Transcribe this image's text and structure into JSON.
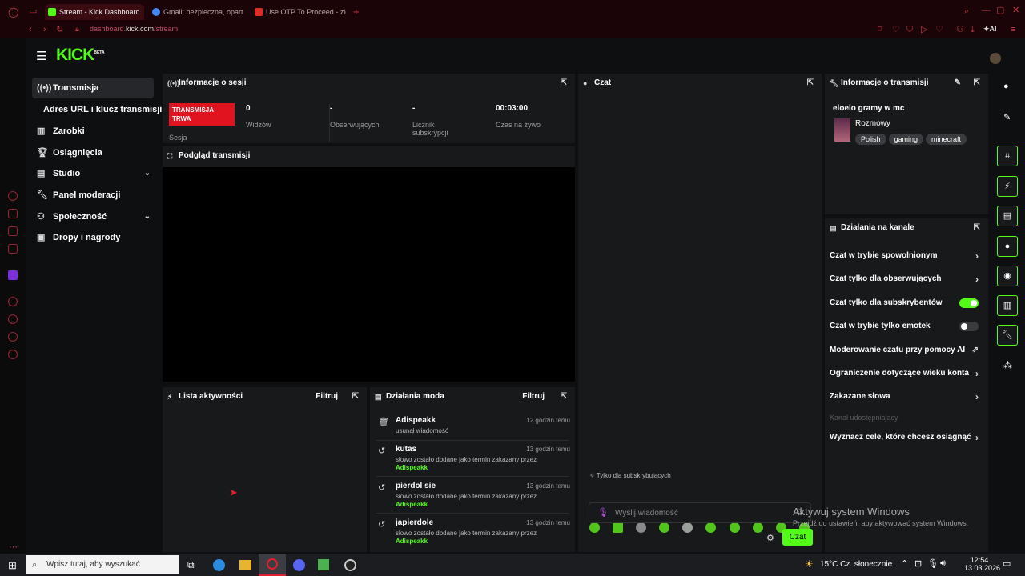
{
  "browser": {
    "tabs": [
      {
        "title": "Stream - Kick Dashboard",
        "active": true
      },
      {
        "title": "Gmail: bezpieczna, opart",
        "active": false
      },
      {
        "title": "Use OTP To Proceed - zie",
        "active": false
      }
    ],
    "url_prefix": "dashboard.",
    "url_domain": "kick.com",
    "url_path": "/stream",
    "ai_label": "AI"
  },
  "logo": "KICK",
  "logo_badge": "BETA",
  "sidebar": {
    "items": [
      {
        "label": "Transmisja",
        "icon": "broadcast-icon"
      },
      {
        "label": "Adres URL i klucz transmisji"
      },
      {
        "label": "Zarobki",
        "icon": "chart-icon"
      },
      {
        "label": "Osiągnięcia",
        "icon": "trophy-icon"
      },
      {
        "label": "Studio",
        "icon": "studio-icon"
      },
      {
        "label": "Panel moderacji",
        "icon": "wrench-icon"
      },
      {
        "label": "Społeczność",
        "icon": "community-icon"
      },
      {
        "label": "Dropy i nagrody",
        "icon": "gift-icon"
      }
    ]
  },
  "session": {
    "title": "Informacje o sesji",
    "status": "TRANSMISJA TRWA",
    "status_label": "Sesja",
    "stats": [
      {
        "value": "0",
        "label": "Widzów"
      },
      {
        "value": "-",
        "label": "Obserwujących"
      },
      {
        "value": "-",
        "label": "Licznik subskrypcji"
      },
      {
        "value": "00:03:00",
        "label": "Czas na żywo"
      }
    ]
  },
  "preview": {
    "title": "Podgląd transmisji"
  },
  "activity": {
    "title": "Lista aktywności",
    "filter": "Filtruj"
  },
  "mod_actions": {
    "title": "Działania moda",
    "filter": "Filtruj",
    "items": [
      {
        "name": "Adispeakk",
        "time": "12 godzin temu",
        "desc": "usunął wiadomość",
        "by": "",
        "icon": "trash-icon"
      },
      {
        "name": "kutas",
        "time": "13 godzin temu",
        "desc": "słowo zostało dodane jako termin zakazany przez",
        "by": "Adispeakk",
        "icon": "history-icon"
      },
      {
        "name": "pierdol sie",
        "time": "13 godzin temu",
        "desc": "słowo zostało dodane jako termin zakazany przez",
        "by": "Adispeakk",
        "icon": "history-icon"
      },
      {
        "name": "japierdole",
        "time": "13 godzin temu",
        "desc": "słowo zostało dodane jako termin zakazany przez",
        "by": "Adispeakk",
        "icon": "history-icon"
      }
    ]
  },
  "chat": {
    "title": "Czat",
    "subs_only_note": "Tylko dla subskrybujących",
    "placeholder": "Wyślij wiadomość",
    "send_label": "Czat"
  },
  "stream_info": {
    "title": "Informacje o transmisji",
    "stream_title": "eloelo gramy w mc",
    "category": "Rozmowy",
    "tags": [
      "Polish",
      "gaming",
      "minecraft"
    ]
  },
  "channel_actions": {
    "title": "Działania na kanale",
    "items": [
      {
        "label": "Czat w trybie spowolnionym",
        "control": "chevron"
      },
      {
        "label": "Czat tylko dla obserwujących",
        "control": "chevron"
      },
      {
        "label": "Czat tylko dla subskrybentów",
        "control": "toggle",
        "on": true
      },
      {
        "label": "Czat w trybie tylko emotek",
        "control": "toggle",
        "on": false
      },
      {
        "label": "Moderowanie czatu przy pomocy AI",
        "control": "external"
      },
      {
        "label": "Ograniczenie dotyczące wieku konta",
        "control": "chevron"
      },
      {
        "label": "Zakazane słowa",
        "control": "chevron"
      },
      {
        "label": "Kanał udostępniający",
        "control": "none",
        "disabled": true
      },
      {
        "label": "Wyznacz cele, które chcesz osiągnąć",
        "control": "chevron"
      }
    ]
  },
  "windows": {
    "activate_title": "Aktywuj system Windows",
    "activate_sub": "Przejdź do ustawień, aby aktywować system Windows.",
    "search_placeholder": "Wpisz tutaj, aby wyszukać",
    "weather": "15°C  Cz. słonecznie",
    "time": "12:54",
    "date": "13.03.2026"
  },
  "colors": {
    "accent": "#53fc18",
    "live_red": "#e0141e",
    "browser_bg": "#1b0407"
  }
}
